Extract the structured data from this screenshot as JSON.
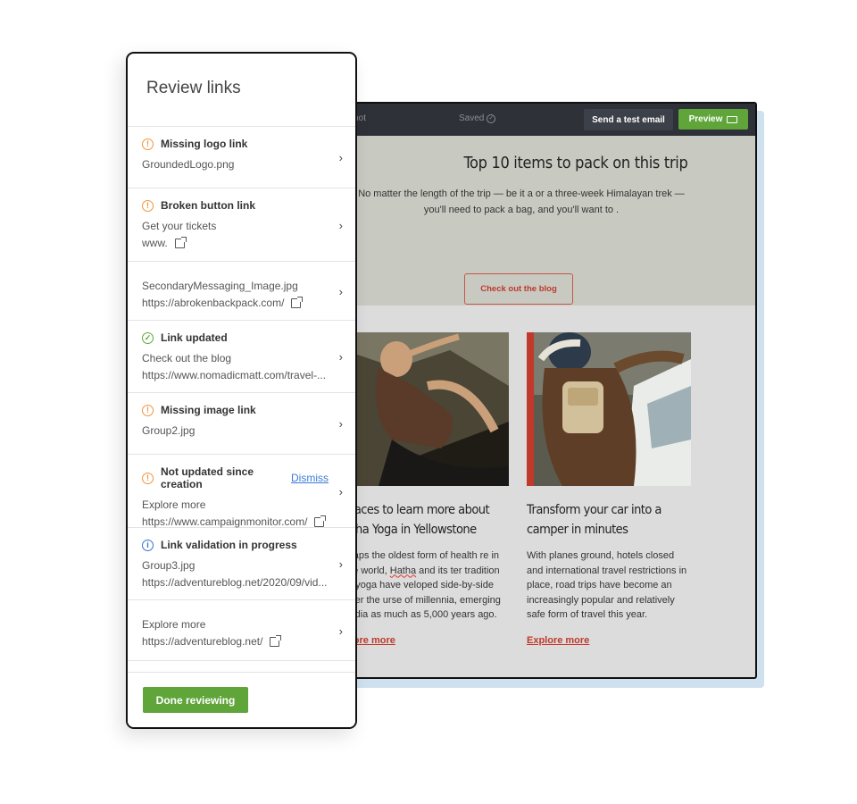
{
  "editor": {
    "topbar": {
      "snapshot_label": "apshot",
      "saved_label": "Saved",
      "test_email_label": "Send a test email",
      "preview_label": "Preview"
    },
    "hero": {
      "title": "Top 10 items to pack on this trip",
      "lede": "No matter the length of the trip — be it a or a three-week Himalayan trek — you'll need to pack a bag, and you'll want to .",
      "cta_label": "Check out the blog"
    },
    "cards": [
      {
        "title": "places to learn more about atha Yoga in Yellowstone",
        "body_pre": "rhaps the oldest form of health re in the world, ",
        "body_squig": "Hatha",
        "body_post": " and its ter tradition of yoga have veloped side-by-side over the urse of millennia, emerging in dia as much as 5,000 years ago.",
        "link": "plore more"
      },
      {
        "title": "Transform your car into a camper in minutes",
        "body": "With planes ground, hotels closed and international travel restrictions in place, road trips have become an increasingly popular and relatively safe form of travel this year.",
        "link": "Explore more"
      }
    ],
    "colors": {
      "topbar": "#2e3138",
      "accent_green": "#5fa53a",
      "accent_red": "#c0392b",
      "hero_bg": "#c8c9c1"
    }
  },
  "review_panel": {
    "title": "Review links",
    "items": [
      {
        "status": "Missing logo link",
        "status_icon": "warning-icon",
        "lines": [
          "GroundedLogo.png"
        ]
      },
      {
        "status": "Broken button link",
        "status_icon": "warning-icon",
        "lines": [
          "Get your tickets",
          "www."
        ]
      },
      {
        "lines": [
          "SecondaryMessaging_Image.jpg",
          "https://abrokenbackpack.com/"
        ]
      },
      {
        "status": "Link updated",
        "status_icon": "check-icon",
        "lines": [
          "Check out the blog",
          "https://www.nomadicmatt.com/travel-..."
        ]
      },
      {
        "status": "Missing image link",
        "status_icon": "warning-icon",
        "lines": [
          "Group2.jpg"
        ]
      },
      {
        "status": "Not updated since creation",
        "status_icon": "warning-icon",
        "dismiss": "Dismiss",
        "lines": [
          "Explore more",
          "https://www.campaignmonitor.com/"
        ]
      },
      {
        "status": "Link validation in progress",
        "status_icon": "info-icon",
        "lines": [
          "Group3.jpg",
          "https://adventureblog.net/2020/09/vid..."
        ]
      },
      {
        "lines": [
          "Explore more",
          "https://adventureblog.net/"
        ]
      }
    ],
    "done_label": "Done reviewing"
  }
}
